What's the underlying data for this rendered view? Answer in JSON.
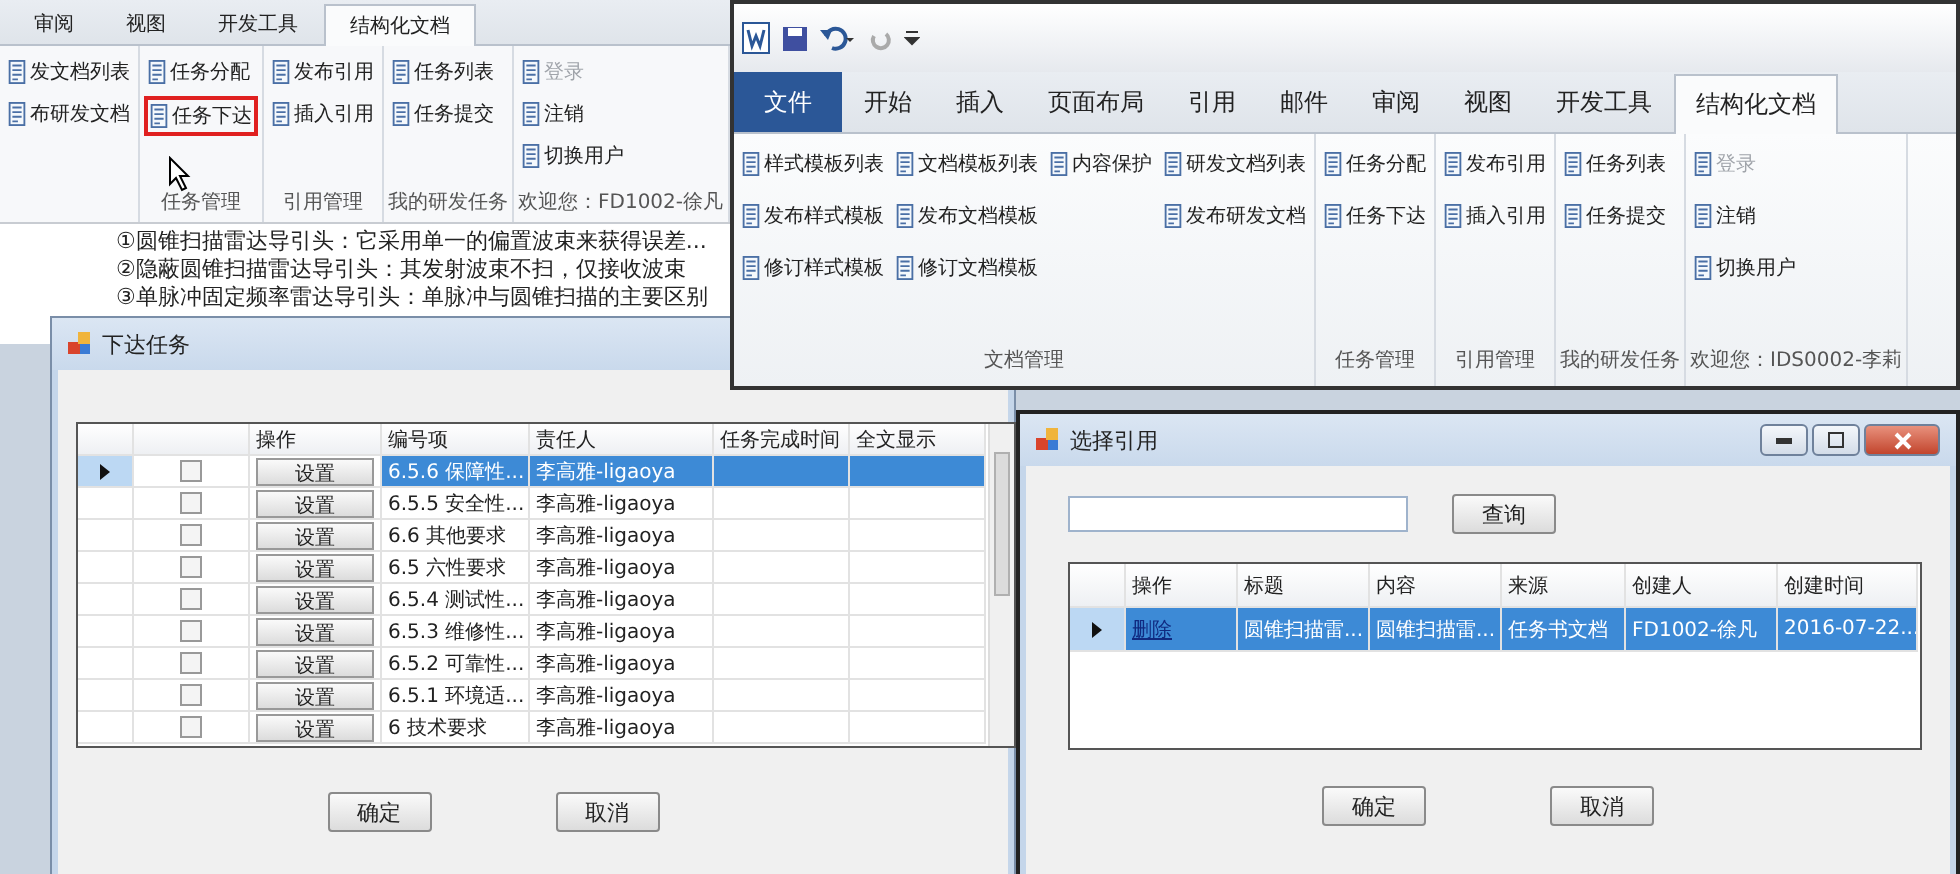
{
  "back_ribbon": {
    "tabs": [
      {
        "label": "审阅",
        "selected": false
      },
      {
        "label": "视图",
        "selected": false
      },
      {
        "label": "开发工具",
        "selected": false
      },
      {
        "label": "结构化文档",
        "selected": true
      }
    ],
    "groups": [
      {
        "columns": [
          [
            {
              "label": "发文档列表",
              "disabled": false,
              "highlighted": false
            },
            {
              "label": "布研发文档",
              "disabled": false,
              "highlighted": false
            }
          ]
        ]
      },
      {
        "label": "任务管理",
        "columns": [
          [
            {
              "label": "任务分配",
              "disabled": false,
              "highlighted": false
            },
            {
              "label": "任务下达",
              "disabled": false,
              "highlighted": true
            }
          ]
        ]
      },
      {
        "label": "引用管理",
        "columns": [
          [
            {
              "label": "发布引用",
              "disabled": false,
              "highlighted": false
            },
            {
              "label": "插入引用",
              "disabled": false,
              "highlighted": false
            }
          ]
        ]
      },
      {
        "label": "我的研发任务",
        "columns": [
          [
            {
              "label": "任务列表",
              "disabled": false,
              "highlighted": false
            },
            {
              "label": "任务提交",
              "disabled": false,
              "highlighted": false
            }
          ]
        ]
      },
      {
        "label": "欢迎您：FD1002-徐凡",
        "columns": [
          [
            {
              "label": "登录",
              "disabled": true,
              "highlighted": false
            },
            {
              "label": "注销",
              "disabled": false,
              "highlighted": false
            },
            {
              "label": "切换用户",
              "disabled": false,
              "highlighted": false
            }
          ]
        ]
      }
    ]
  },
  "document": {
    "lines": [
      "①圆锥扫描雷达导引头：它采用单一的偏置波束来获得误差...",
      "②隐蔽圆锥扫描雷达导引头：其发射波束不扫，仅接收波束",
      "③单脉冲固定频率雷达导引头：单脉冲与圆锥扫描的主要区别"
    ]
  },
  "front_ribbon": {
    "tabs": [
      {
        "label": "文件",
        "kind": "file",
        "selected": false
      },
      {
        "label": "开始",
        "kind": "tab",
        "selected": false
      },
      {
        "label": "插入",
        "kind": "tab",
        "selected": false
      },
      {
        "label": "页面布局",
        "kind": "tab",
        "selected": false
      },
      {
        "label": "引用",
        "kind": "tab",
        "selected": false
      },
      {
        "label": "邮件",
        "kind": "tab",
        "selected": false
      },
      {
        "label": "审阅",
        "kind": "tab",
        "selected": false
      },
      {
        "label": "视图",
        "kind": "tab",
        "selected": false
      },
      {
        "label": "开发工具",
        "kind": "tab",
        "selected": false
      },
      {
        "label": "结构化文档",
        "kind": "tab",
        "selected": true
      }
    ],
    "groups": [
      {
        "label": "文档管理",
        "columns": [
          [
            {
              "label": "样式模板列表",
              "disabled": false,
              "highlighted": false
            },
            {
              "label": "发布样式模板",
              "disabled": false,
              "highlighted": false
            },
            {
              "label": "修订样式模板",
              "disabled": false,
              "highlighted": false
            }
          ],
          [
            {
              "label": "文档模板列表",
              "disabled": false,
              "highlighted": false
            },
            {
              "label": "发布文档模板",
              "disabled": false,
              "highlighted": false
            },
            {
              "label": "修订文档模板",
              "disabled": false,
              "highlighted": false
            }
          ],
          [
            {
              "label": "内容保护",
              "disabled": false,
              "highlighted": false
            }
          ],
          [
            {
              "label": "研发文档列表",
              "disabled": false,
              "highlighted": false
            },
            {
              "label": "发布研发文档",
              "disabled": false,
              "highlighted": false
            }
          ]
        ]
      },
      {
        "label": "任务管理",
        "columns": [
          [
            {
              "label": "任务分配",
              "disabled": false,
              "highlighted": false
            },
            {
              "label": "任务下达",
              "disabled": false,
              "highlighted": false
            }
          ]
        ]
      },
      {
        "label": "引用管理",
        "columns": [
          [
            {
              "label": "发布引用",
              "disabled": false,
              "highlighted": false
            },
            {
              "label": "插入引用",
              "disabled": false,
              "highlighted": false
            }
          ]
        ]
      },
      {
        "label": "我的研发任务",
        "columns": [
          [
            {
              "label": "任务列表",
              "disabled": false,
              "highlighted": false
            },
            {
              "label": "任务提交",
              "disabled": false,
              "highlighted": false
            }
          ]
        ]
      },
      {
        "label": "欢迎您：IDS0002-李莉",
        "columns": [
          [
            {
              "label": "登录",
              "disabled": true,
              "highlighted": false
            },
            {
              "label": "注销",
              "disabled": false,
              "highlighted": false
            },
            {
              "label": "切换用户",
              "disabled": false,
              "highlighted": false
            }
          ]
        ]
      }
    ]
  },
  "assign_dialog": {
    "title": "下达任务",
    "columns": [
      "操作",
      "编号项",
      "责任人",
      "任务完成时间",
      "全文显示"
    ],
    "rows": [
      {
        "selected": true,
        "checked": false,
        "action": "设置",
        "code": "6.5.6 保障性...",
        "owner": "李高雅-ligaoya"
      },
      {
        "selected": false,
        "checked": false,
        "action": "设置",
        "code": "6.5.5 安全性...",
        "owner": "李高雅-ligaoya"
      },
      {
        "selected": false,
        "checked": false,
        "action": "设置",
        "code": "6.6 其他要求",
        "owner": "李高雅-ligaoya"
      },
      {
        "selected": false,
        "checked": false,
        "action": "设置",
        "code": "6.5 六性要求",
        "owner": "李高雅-ligaoya"
      },
      {
        "selected": false,
        "checked": false,
        "action": "设置",
        "code": "6.5.4 测试性...",
        "owner": "李高雅-ligaoya"
      },
      {
        "selected": false,
        "checked": false,
        "action": "设置",
        "code": "6.5.3 维修性...",
        "owner": "李高雅-ligaoya"
      },
      {
        "selected": false,
        "checked": false,
        "action": "设置",
        "code": "6.5.2 可靠性...",
        "owner": "李高雅-ligaoya"
      },
      {
        "selected": false,
        "checked": false,
        "action": "设置",
        "code": "6.5.1 环境适...",
        "owner": "李高雅-ligaoya"
      },
      {
        "selected": false,
        "checked": false,
        "action": "设置",
        "code": "6 技术要求",
        "owner": "李高雅-ligaoya"
      }
    ],
    "buttons": [
      "确定",
      "取消"
    ]
  },
  "reference_dialog": {
    "title": "选择引用",
    "search_button": "查询",
    "columns": [
      "操作",
      "标题",
      "内容",
      "来源",
      "创建人",
      "创建时间"
    ],
    "rows": [
      {
        "selected": true,
        "cells": [
          "删除",
          "圆锥扫描雷...",
          "圆锥扫描雷...",
          "任务书文档",
          "FD1002-徐凡",
          "2016-07-22..."
        ]
      }
    ],
    "buttons": [
      "确定",
      "取消"
    ]
  }
}
